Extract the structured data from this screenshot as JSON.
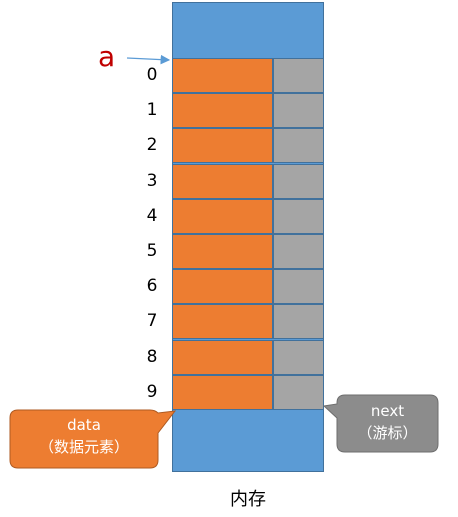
{
  "diagram": {
    "pointer_label": "a",
    "indices": [
      "0",
      "1",
      "2",
      "3",
      "4",
      "5",
      "6",
      "7",
      "8",
      "9"
    ],
    "data_callout": {
      "line1": "data",
      "line2": "（数据元素）"
    },
    "next_callout": {
      "line1": "next",
      "line2": "（游标）"
    },
    "memory_label": "内存"
  },
  "colors": {
    "memory": "#5b9bd5",
    "data_cell": "#ed7d31",
    "next_cell": "#a5a5a5",
    "pointer": "#c00000",
    "arrow": "#5b9bd5"
  }
}
